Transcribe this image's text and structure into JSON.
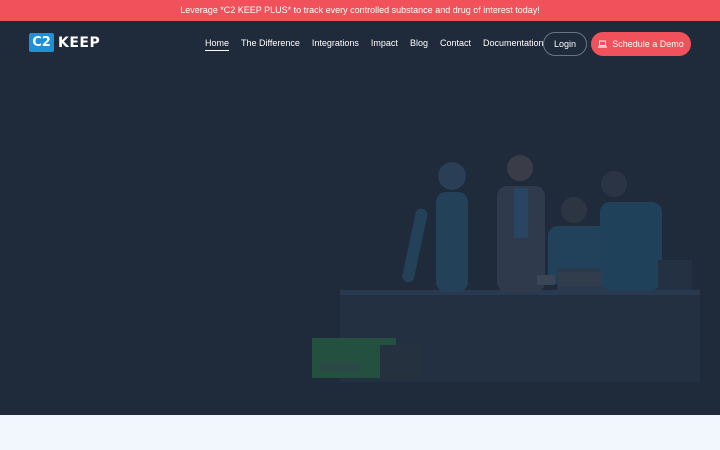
{
  "announcement": "Leverage *C2 KEEP PLUS* to track every controlled substance and drug of interest today!",
  "logo": {
    "mark": "C2",
    "word": "KEEP"
  },
  "nav": {
    "links": [
      {
        "label": "Home",
        "active": true
      },
      {
        "label": "The Difference"
      },
      {
        "label": "Integrations"
      },
      {
        "label": "Impact"
      },
      {
        "label": "Blog"
      },
      {
        "label": "Contact"
      },
      {
        "label": "Documentation"
      }
    ],
    "login_label": "Login",
    "demo_label": "Schedule a Demo",
    "demo_icon": "laptop-icon"
  },
  "colors": {
    "accent": "#f0515a",
    "background": "#1f2a3a",
    "logo_blue": "#1e90d6",
    "band": "#f1f7fc"
  }
}
